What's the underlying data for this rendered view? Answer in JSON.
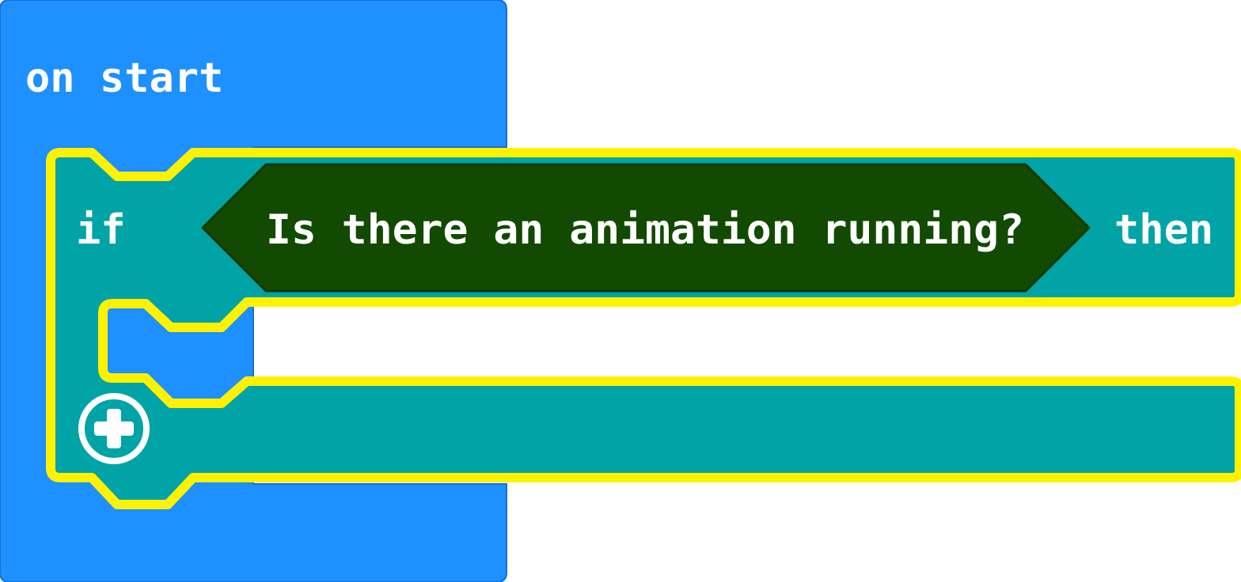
{
  "workspace": {
    "on_start_block": {
      "label": "on start",
      "color": "#1E90FF",
      "border_color": "#1A6FD6"
    },
    "if_block": {
      "if_label": "if",
      "then_label": "then",
      "color": "#00A4A6",
      "highlight_color": "#FFF200",
      "add_icon": "plus-circle-icon",
      "condition": {
        "label": "Is there an animation running?",
        "color": "#114A00"
      }
    }
  }
}
